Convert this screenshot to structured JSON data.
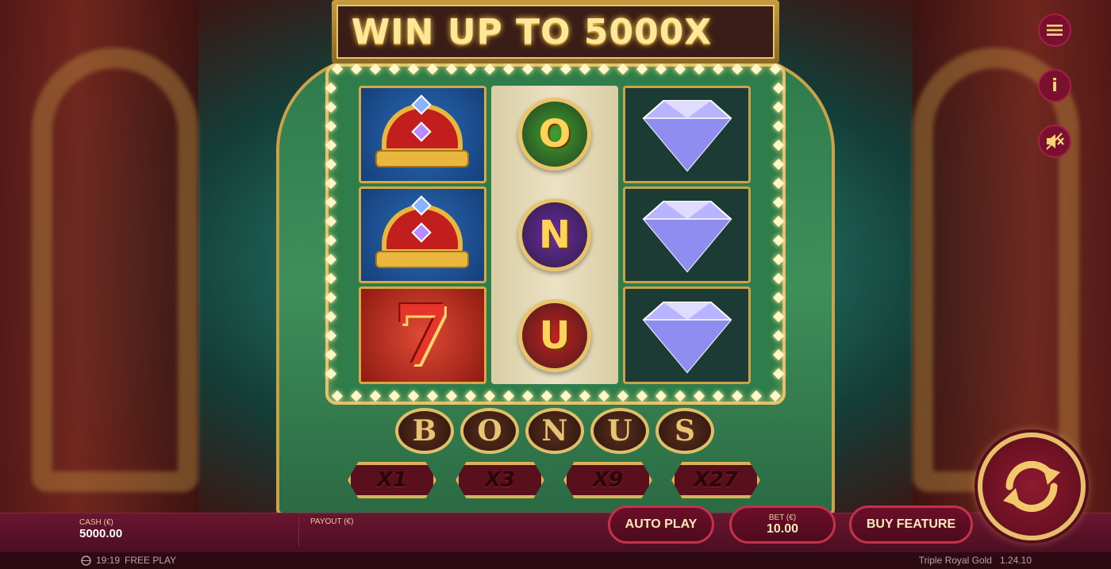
{
  "game": {
    "marquee": "WIN UP TO 5000X",
    "reel_left": [
      "crown",
      "crown",
      "seven"
    ],
    "reel_left_seven_glyph": "7",
    "reel_middle": [
      {
        "letter": "O",
        "color": "#3fa02e"
      },
      {
        "letter": "N",
        "color": "#6a2aa6"
      },
      {
        "letter": "U",
        "color": "#c42020"
      }
    ],
    "reel_right": [
      "diamond",
      "diamond",
      "diamond"
    ],
    "bonus_letters": [
      "B",
      "O",
      "N",
      "U",
      "S"
    ],
    "multipliers": [
      "X1",
      "X3",
      "X9",
      "X27"
    ]
  },
  "icons": {
    "menu": "menu-icon",
    "info": "info-icon",
    "info_glyph": "i",
    "sound": "sound-muted-icon",
    "spin": "spin-icon"
  },
  "bottom_bar": {
    "cash_label": "CASH (€)",
    "cash_value": "5000.00",
    "payout_label": "PAYOUT (€)",
    "auto_play": "AUTO PLAY",
    "bet_label": "BET (€)",
    "bet_value": "10.00",
    "buy_feature": "BUY FEATURE"
  },
  "footer": {
    "time": "19:19",
    "mode": "FREE PLAY",
    "game_name": "Triple Royal Gold",
    "version": "1.24.10"
  },
  "colors": {
    "accent_gold": "#e9c46a",
    "bar_red": "#6a1630",
    "machine_green": "#2f7a4c"
  }
}
